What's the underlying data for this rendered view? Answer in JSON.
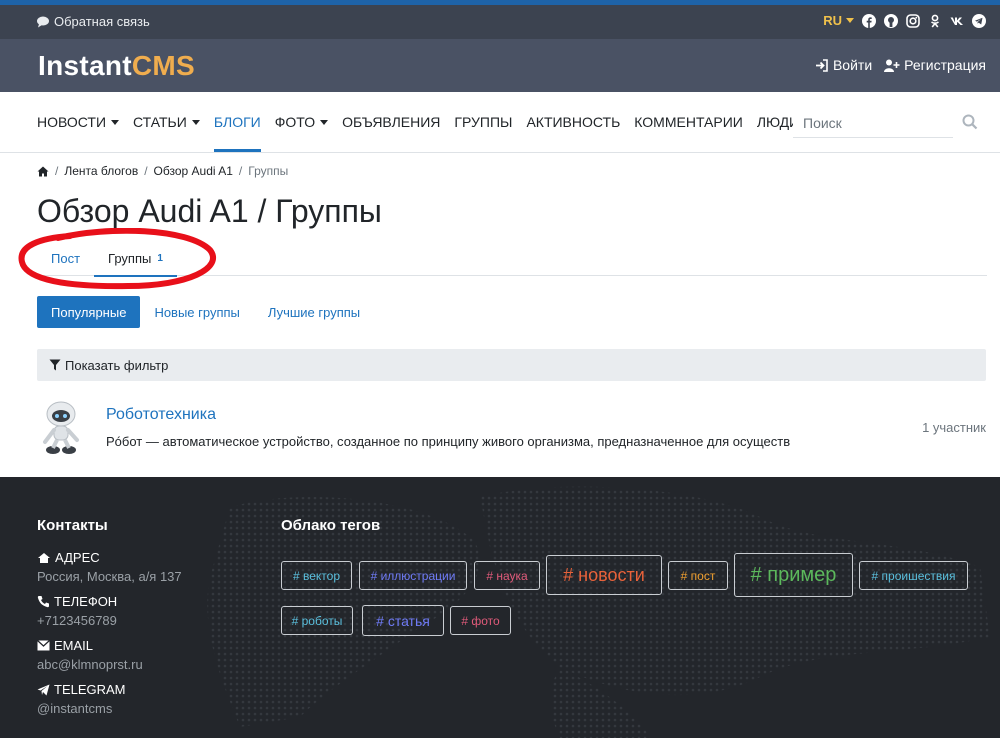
{
  "topbar": {
    "feedback": "Обратная связь",
    "lang": "RU",
    "social_icons": [
      "facebook-icon",
      "github-icon",
      "instagram-icon",
      "odnoklassniki-icon",
      "vk-icon",
      "telegram-icon"
    ]
  },
  "header": {
    "logo_part1": "Instant",
    "logo_part2": "CMS",
    "login": "Войти",
    "register": "Регистрация"
  },
  "nav": {
    "items": [
      {
        "label": "НОВОСТИ"
      },
      {
        "label": "СТАТЬИ"
      },
      {
        "label": "БЛОГИ"
      },
      {
        "label": "ФОТО"
      },
      {
        "label": "ОБЪЯВЛЕНИЯ"
      },
      {
        "label": "ГРУППЫ"
      },
      {
        "label": "АКТИВНОСТЬ"
      },
      {
        "label": "КОММЕНТАРИИ"
      },
      {
        "label": "ЛЮДИ"
      }
    ],
    "search_placeholder": "Поиск"
  },
  "breadcrumbs": [
    "Лента блогов",
    "Обзор Audi A1",
    "Группы"
  ],
  "page_title": "Обзор Audi A1 / Группы",
  "tabs": [
    {
      "label": "Пост",
      "count": ""
    },
    {
      "label": "Группы",
      "count": "1"
    }
  ],
  "subtabs": [
    "Популярные",
    "Новые группы",
    "Лучшие группы"
  ],
  "filter_label": "Показать фильтр",
  "group": {
    "name": "Робототехника",
    "description": "Рóбот — автоматическое устройство, созданное по принципу живого организма, предназначенное для осуществ",
    "members": "1 участник"
  },
  "footer": {
    "contacts_title": "Контакты",
    "address_label": "АДРЕС",
    "address": "Россия, Москва, а/я 137",
    "phone_label": "ТЕЛЕФОН",
    "phone": "+7123456789",
    "email_label": "EMAIL",
    "email": "abc@klmnoprst.ru",
    "telegram_label": "TELEGRAM",
    "telegram": "@instantcms",
    "tags_title": "Облако тегов",
    "tags": [
      {
        "label": "вектор",
        "color": "#5bc0de"
      },
      {
        "label": "иллюстрации",
        "color": "#6f7bf7"
      },
      {
        "label": "наука",
        "color": "#e05a7a"
      },
      {
        "label": "новости",
        "color": "#e8623a"
      },
      {
        "label": "пост",
        "color": "#f0a030"
      },
      {
        "label": "пример",
        "color": "#5cb85c"
      },
      {
        "label": "проишествия",
        "color": "#5bc0de"
      },
      {
        "label": "роботы",
        "color": "#5bc0de"
      },
      {
        "label": "статья",
        "color": "#6f7bf7"
      },
      {
        "label": "фото",
        "color": "#e05a7a"
      }
    ]
  },
  "colors": {
    "accent": "#1e73be",
    "header": "#4a5264",
    "topbar": "#3c4350",
    "annotation": "#e8101a"
  }
}
